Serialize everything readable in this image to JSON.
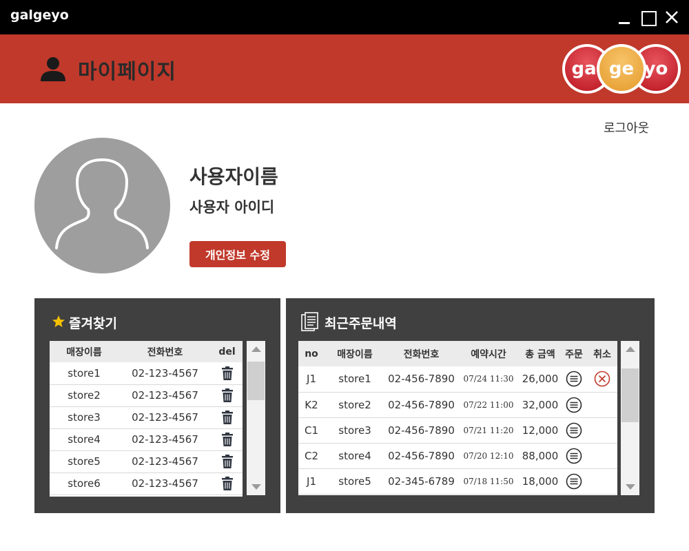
{
  "window": {
    "title": "galgeyo"
  },
  "header": {
    "page_title": "마이페이지",
    "logo": [
      "gal",
      "ge",
      "yo"
    ]
  },
  "logout_label": "로그아웃",
  "profile": {
    "user_name": "사용자이름",
    "user_id": "사용자 아이디",
    "edit_label": "개인정보 수정"
  },
  "favorites": {
    "title": "즐겨찾기",
    "columns": [
      "매장이름",
      "전화번호",
      "del"
    ],
    "rows": [
      {
        "store": "store1",
        "phone": "02-123-4567"
      },
      {
        "store": "store2",
        "phone": "02-123-4567"
      },
      {
        "store": "store3",
        "phone": "02-123-4567"
      },
      {
        "store": "store4",
        "phone": "02-123-4567"
      },
      {
        "store": "store5",
        "phone": "02-123-4567"
      },
      {
        "store": "store6",
        "phone": "02-123-4567"
      }
    ]
  },
  "orders": {
    "title": "최근주문내역",
    "columns": [
      "no",
      "매장이름",
      "전화번호",
      "예약시간",
      "총 금액",
      "주문",
      "취소"
    ],
    "rows": [
      {
        "no": "J1",
        "store": "store1",
        "phone": "02-456-7890",
        "time": "07/24 11:30",
        "amount": "26,000",
        "cancel": true
      },
      {
        "no": "K2",
        "store": "store2",
        "phone": "02-456-7890",
        "time": "07/22 11:00",
        "amount": "32,000",
        "cancel": false
      },
      {
        "no": "C1",
        "store": "store3",
        "phone": "02-456-7890",
        "time": "07/21 11:20",
        "amount": "12,000",
        "cancel": false
      },
      {
        "no": "C2",
        "store": "store4",
        "phone": "02-456-7890",
        "time": "07/20 12:10",
        "amount": "88,000",
        "cancel": false
      },
      {
        "no": "J1",
        "store": "store5",
        "phone": "02-345-6789",
        "time": "07/18 11:50",
        "amount": "18,000",
        "cancel": false
      }
    ]
  },
  "colors": {
    "header_red": "#c0392b",
    "panel_dark": "#404040",
    "star_yellow": "#f5c000",
    "cancel_red": "#c0392b"
  }
}
